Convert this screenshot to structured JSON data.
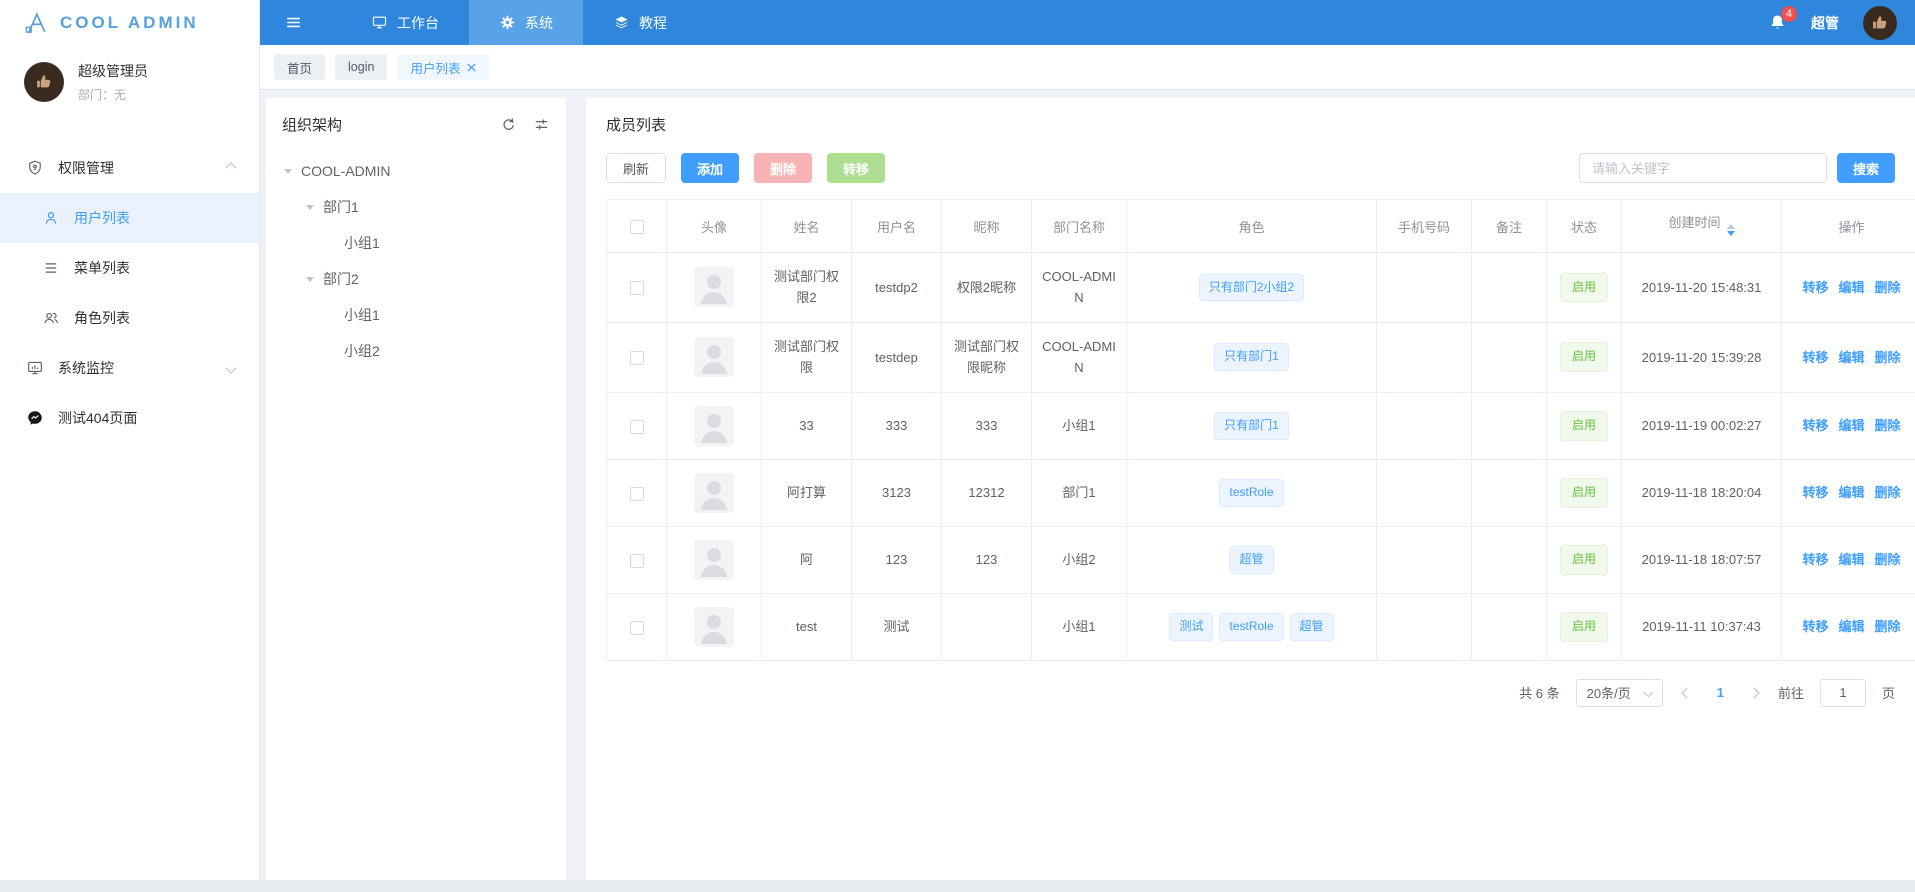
{
  "app": {
    "logo_text": "COOL ADMIN"
  },
  "navbar": {
    "tabs": [
      {
        "label": "工作台",
        "icon": "workbench-monitor-icon",
        "active": false
      },
      {
        "label": "系统",
        "icon": "gear-icon",
        "active": true
      },
      {
        "label": "教程",
        "icon": "layers-icon",
        "active": false
      }
    ],
    "notification_count": "4",
    "username": "超管",
    "icons": [
      "hamburger-icon",
      "bell-icon",
      "user-avatar"
    ]
  },
  "sidebar": {
    "user": {
      "name": "超级管理员",
      "dept": "部门：无"
    },
    "items": [
      {
        "label": "权限管理",
        "icon": "shield-key-icon",
        "expanded": true
      },
      {
        "label": "用户列表",
        "icon": "user-icon",
        "active": true
      },
      {
        "label": "菜单列表",
        "icon": "menu-list-icon",
        "active": false
      },
      {
        "label": "角色列表",
        "icon": "users-icon",
        "active": false
      },
      {
        "label": "系统监控",
        "icon": "monitor-chart-icon",
        "expanded": false
      },
      {
        "label": "测试404页面",
        "icon": "chat-bubble-icon",
        "active": false
      }
    ]
  },
  "tags": [
    {
      "label": "首页",
      "active": false
    },
    {
      "label": "login",
      "active": false
    },
    {
      "label": "用户列表",
      "active": true,
      "closable": true
    }
  ],
  "org_panel": {
    "title": "组织架构",
    "icons": [
      "refresh-icon",
      "sliders-icon"
    ],
    "tree": [
      {
        "label": "COOL-ADMIN",
        "children": [
          {
            "label": "部门1",
            "children": [
              {
                "label": "小组1"
              }
            ]
          },
          {
            "label": "部门2",
            "children": [
              {
                "label": "小组1"
              },
              {
                "label": "小组2"
              }
            ]
          }
        ]
      }
    ]
  },
  "member_panel": {
    "title": "成员列表",
    "toolbar": {
      "refresh": "刷新",
      "add": "添加",
      "delete": "删除",
      "transfer": "转移"
    },
    "search": {
      "placeholder": "请输入关键字",
      "button": "搜索"
    },
    "table": {
      "columns": [
        "头像",
        "姓名",
        "用户名",
        "昵称",
        "部门名称",
        "角色",
        "手机号码",
        "备注",
        "状态",
        "创建时间",
        "操作"
      ],
      "actions": [
        "转移",
        "编辑",
        "删除"
      ],
      "rows": [
        {
          "name": "测试部门权限2",
          "username": "testdp2",
          "nickname": "权限2昵称",
          "dept": "COOL-ADMIN",
          "roles": [
            "只有部门2小组2"
          ],
          "phone": "",
          "remark": "",
          "status": "启用",
          "created": "2019-11-20 15:48:31"
        },
        {
          "name": "测试部门权限",
          "username": "testdep",
          "nickname": "测试部门权限昵称",
          "dept": "COOL-ADMIN",
          "roles": [
            "只有部门1"
          ],
          "phone": "",
          "remark": "",
          "status": "启用",
          "created": "2019-11-20 15:39:28"
        },
        {
          "name": "33",
          "username": "333",
          "nickname": "333",
          "dept": "小组1",
          "roles": [
            "只有部门1"
          ],
          "phone": "",
          "remark": "",
          "status": "启用",
          "created": "2019-11-19 00:02:27"
        },
        {
          "name": "阿打算",
          "username": "3123",
          "nickname": "12312",
          "dept": "部门1",
          "roles": [
            "testRole"
          ],
          "phone": "",
          "remark": "",
          "status": "启用",
          "created": "2019-11-18 18:20:04"
        },
        {
          "name": "阿",
          "username": "123",
          "nickname": "123",
          "dept": "小组2",
          "roles": [
            "超管"
          ],
          "phone": "",
          "remark": "",
          "status": "启用",
          "created": "2019-11-18 18:07:57"
        },
        {
          "name": "test",
          "username": "测试",
          "nickname": "",
          "dept": "小组1",
          "roles": [
            "测试",
            "testRole",
            "超管"
          ],
          "phone": "",
          "remark": "",
          "status": "启用",
          "created": "2019-11-11 10:37:43"
        }
      ]
    },
    "pagination": {
      "total": "共 6 条",
      "page_size": "20条/页",
      "current_page": "1",
      "goto_label": "前往",
      "goto_value": "1",
      "page_unit": "页"
    }
  },
  "colors": {
    "primary": "#409eff",
    "navbar": "#2e87dd",
    "navbar_active_tab": "#58a3e8",
    "success": "#67c23a",
    "danger_disabled": "#f8b4b4",
    "success_disabled": "#aede92",
    "badge": "#f05353",
    "role_tag_bg": "#ecf5ff",
    "status_tag_bg": "#f0f9eb"
  }
}
